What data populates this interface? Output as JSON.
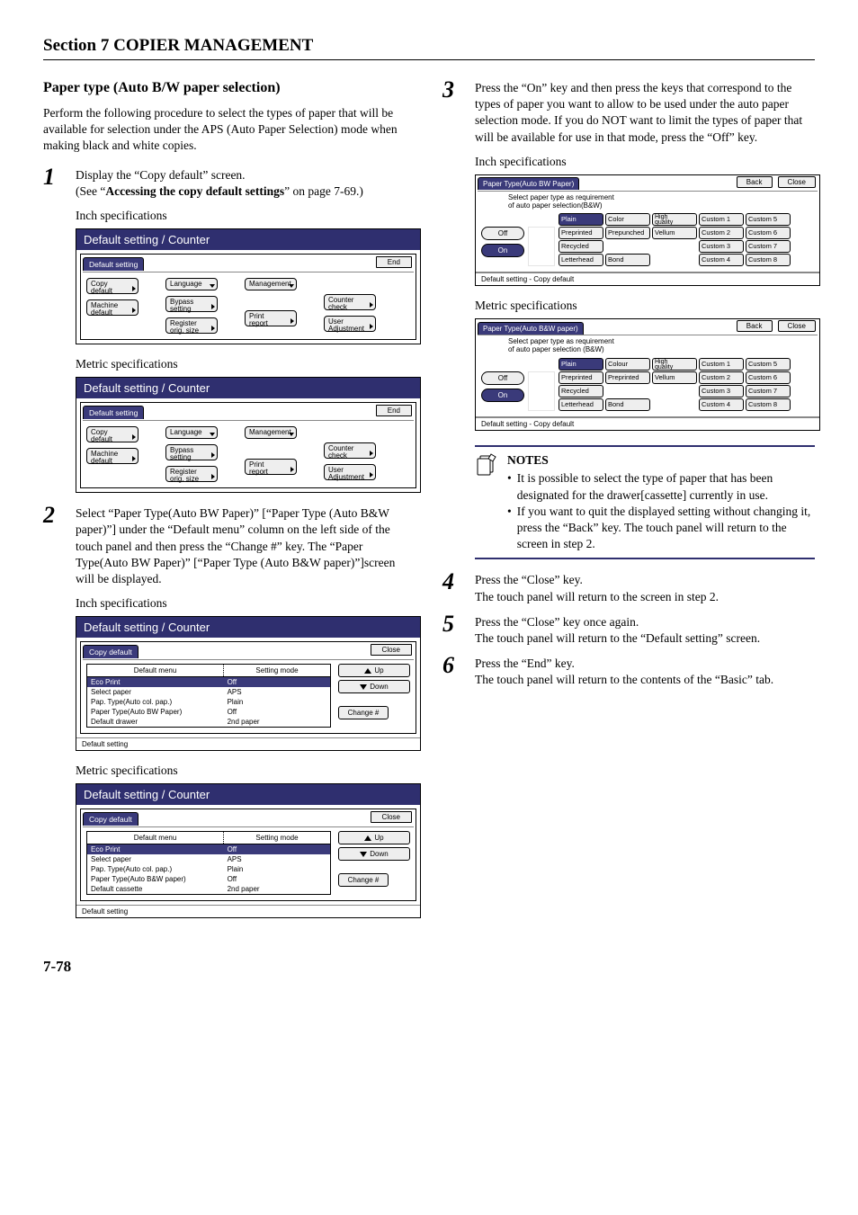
{
  "section_header": "Section 7  COPIER MANAGEMENT",
  "heading": "Paper type (Auto B/W paper selection)",
  "intro": "Perform the following procedure to select the types of paper that will be available for selection under the APS (Auto Paper Selection) mode when making black and white copies.",
  "step1": {
    "num": "1",
    "line1": "Display the “Copy default” screen.",
    "line2a": "(See “",
    "line2b": "Accessing the copy default settings",
    "line2c": "” on page 7-69.)"
  },
  "inch_spec": "Inch specifications",
  "metric_spec": "Metric specifications",
  "panelA": {
    "title": "Default setting / Counter",
    "tab": "Default setting",
    "end": "End",
    "btns_c1": [
      "Copy\ndefault",
      "Machine\ndefault"
    ],
    "btns_c2": [
      "Language",
      "Bypass\nsetting",
      "Register\norig. size"
    ],
    "btns_c3": [
      "Management",
      "Print\nreport"
    ],
    "btns_c4": [
      "Counter\ncheck",
      "User\nAdjustment"
    ]
  },
  "step2": {
    "num": "2",
    "text": "Select “Paper Type(Auto BW Paper)” [“Paper Type (Auto B&W paper)”] under the “Default menu” column on the left side of the touch panel and then press the “Change #” key. The “Paper Type(Auto BW Paper)” [“Paper Type (Auto B&W paper)”]screen will be displayed."
  },
  "panelB_inch": {
    "title": "Default setting / Counter",
    "tab": "Copy default",
    "close": "Close",
    "h1": "Default menu",
    "h2": "Setting mode",
    "rows": [
      {
        "m": "Eco Print",
        "s": "Off",
        "sel": true
      },
      {
        "m": "Select paper",
        "s": "APS"
      },
      {
        "m": "Pap. Type(Auto col. pap.)",
        "s": "Plain"
      },
      {
        "m": "Paper Type(Auto BW Paper)",
        "s": "Off"
      },
      {
        "m": "Default drawer",
        "s": "2nd paper"
      }
    ],
    "up": "Up",
    "down": "Down",
    "change": "Change #",
    "bc": "Default setting"
  },
  "panelB_metric": {
    "title": "Default setting / Counter",
    "tab": "Copy default",
    "close": "Close",
    "h1": "Default menu",
    "h2": "Setting mode",
    "rows": [
      {
        "m": "Eco Print",
        "s": "Off",
        "sel": true
      },
      {
        "m": "Select paper",
        "s": "APS"
      },
      {
        "m": "Pap. Type(Auto col. pap.)",
        "s": "Plain"
      },
      {
        "m": "Paper Type(Auto B&W paper)",
        "s": "Off"
      },
      {
        "m": "Default cassette",
        "s": "2nd paper"
      }
    ],
    "up": "Up",
    "down": "Down",
    "change": "Change #",
    "bc": "Default setting"
  },
  "step3": {
    "num": "3",
    "text": "Press the “On” key and then press the keys that correspond to the types of paper you want to allow to be used under the auto paper selection mode. If you do NOT want to limit the types of paper that will be available for use in that mode, press the “Off” key."
  },
  "panelC_inch": {
    "tab": "Paper Type(Auto BW Paper)",
    "back": "Back",
    "close": "Close",
    "instr": "Select paper type as requirement\nof auto paper selection(B&W)",
    "off": "Off",
    "on": "On",
    "row1": [
      "Plain",
      "Color",
      "High\nquality",
      "Custom 1",
      "Custom 5"
    ],
    "row2": [
      "Preprinted",
      "Prepunched",
      "Vellum",
      "Custom 2",
      "Custom 6"
    ],
    "row3": [
      "Recycled",
      "",
      "",
      "Custom 3",
      "Custom 7"
    ],
    "row4": [
      "Letterhead",
      "Bond",
      "",
      "Custom 4",
      "Custom 8"
    ],
    "bc": "Default setting - Copy default"
  },
  "panelC_metric": {
    "tab": "Paper Type(Auto B&W paper)",
    "back": "Back",
    "close": "Close",
    "instr": "Select paper type as requirement\nof auto paper selection (B&W)",
    "off": "Off",
    "on": "On",
    "row1": [
      "Plain",
      "Colour",
      "High\nquality",
      "Custom 1",
      "Custom 5"
    ],
    "row2": [
      "Preprinted",
      "Preprinted",
      "Vellum",
      "Custom 2",
      "Custom 6"
    ],
    "row3": [
      "Recycled",
      "",
      "",
      "Custom 3",
      "Custom 7"
    ],
    "row4": [
      "Letterhead",
      "Bond",
      "",
      "Custom 4",
      "Custom 8"
    ],
    "bc": "Default setting - Copy default"
  },
  "notes": {
    "title": "NOTES",
    "b1": "It is possible to select the type of paper that has been designated for the drawer[cassette] currently in use.",
    "b2": "If you want to quit the displayed setting without changing it, press the “Back” key. The touch panel will return to the screen in step 2."
  },
  "step4": {
    "num": "4",
    "l1": "Press the “Close” key.",
    "l2": "The touch panel will return to the screen in step 2."
  },
  "step5": {
    "num": "5",
    "l1": "Press the “Close” key once again.",
    "l2": "The touch panel will return to the “Default setting” screen."
  },
  "step6": {
    "num": "6",
    "l1": "Press the “End” key.",
    "l2": "The touch panel will return to the contents of the “Basic” tab."
  },
  "page_num": "7-78"
}
